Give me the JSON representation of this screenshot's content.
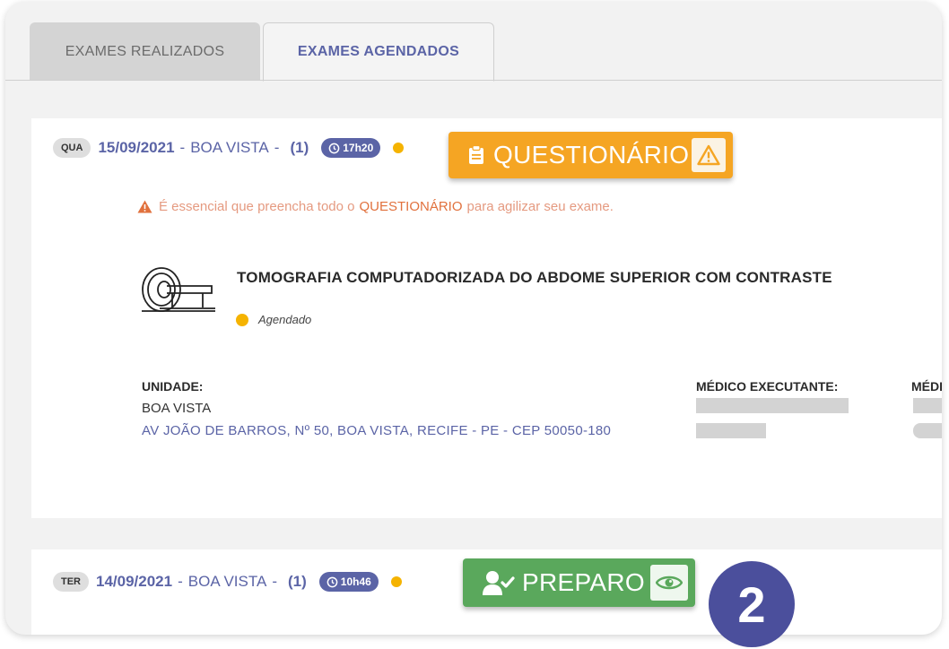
{
  "tabs": [
    {
      "label": "EXAMES REALIZADOS",
      "active": false
    },
    {
      "label": "EXAMES AGENDADOS",
      "active": true
    }
  ],
  "appointments": [
    {
      "day": "QUA",
      "date": "15/09/2021",
      "separator": "-",
      "unit": "BOA VISTA",
      "count": "(1)",
      "time": "17h20",
      "status_dot_color": "#f5b301",
      "action_button": {
        "label": "QUESTIONÁRIO",
        "color": "#f5a523",
        "left_icon": "clipboard-icon",
        "right_icon": "warning-icon"
      },
      "warning": {
        "prefix": "É essencial que preencha todo o",
        "highlight": "QUESTIONÁRIO",
        "suffix": "para agilizar seu exame."
      },
      "exam": {
        "icon": "ct-scanner-icon",
        "title": "TOMOGRAFIA COMPUTADORIZADA DO ABDOME SUPERIOR COM CONTRASTE",
        "status": "Agendado"
      },
      "details": {
        "unit_label": "UNIDADE:",
        "unit_name": "BOA VISTA",
        "unit_address": "AV JOÃO DE BARROS, Nº 50, BOA VISTA, RECIFE - PE - CEP 50050-180",
        "doctor_label": "MÉDICO EXECUTANTE:",
        "third_label": "MÉDI"
      }
    },
    {
      "day": "TER",
      "date": "14/09/2021",
      "separator": "-",
      "unit": "BOA VISTA",
      "count": "(1)",
      "time": "10h46",
      "status_dot_color": "#f5b301",
      "action_button": {
        "label": "PREPARO",
        "color": "#5aa85c",
        "left_icon": "user-check-icon",
        "right_icon": "eye-icon"
      }
    }
  ],
  "step_badge": "2"
}
